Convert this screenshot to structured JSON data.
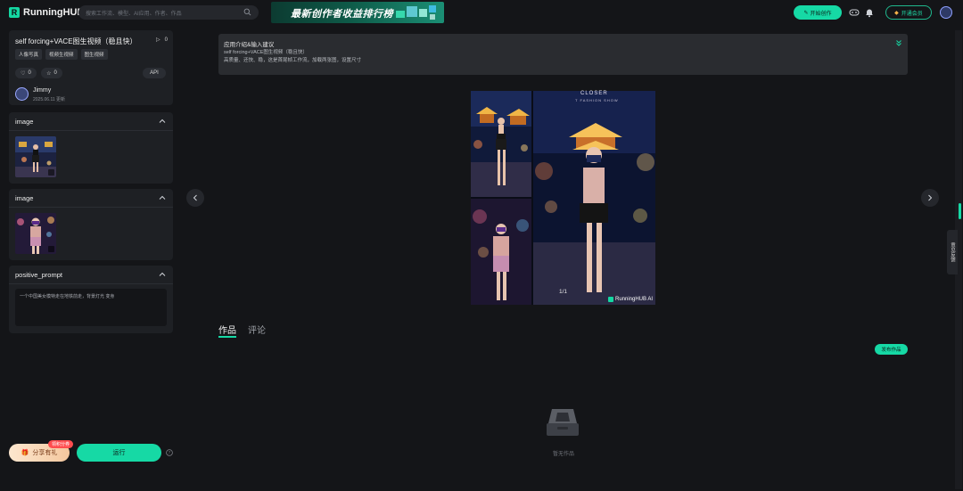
{
  "header": {
    "logo_text": "RunningHUB",
    "search_placeholder": "搜索工作流、模型、AI应用、作者、作品",
    "banner_text": "最新创作者收益排行榜",
    "create_label": "开始创作",
    "vip_label": "开通会员"
  },
  "workflow": {
    "title": "self forcing+VACE图生视频（稳且快）",
    "run_count": "0",
    "tags": [
      "人像写真",
      "视频生视频",
      "图生视频"
    ],
    "likes": "0",
    "favorites": "0",
    "api_label": "API",
    "author_name": "Jimmy",
    "updated": "2025.06.11 更新"
  },
  "panels": {
    "image1_label": "image",
    "image2_label": "image",
    "prompt_label": "positive_prompt",
    "prompt_value": "一个中国美女模特走在地铁前走，背景灯光 变身"
  },
  "actions": {
    "share_label": "分享有礼",
    "share_badge": "领积分券",
    "run_label": "运行"
  },
  "intro": {
    "title": "应用介绍&输入建议",
    "line1": "self forcing+VACE图生视频（稳且快）",
    "line2": "高质量、还快、稳，这是首尾帧工作流，加载两张图，设置尺寸"
  },
  "gallery": {
    "counter": "1/1",
    "watermark": "RunningHUB AI",
    "caption_main": "CLOSER",
    "caption_sub": "T FASHION SHOW"
  },
  "tabs": {
    "works": "作品",
    "comments": "评论"
  },
  "works": {
    "publish_label": "发布作品",
    "empty_text": "暂无作品"
  },
  "sidebar_float": {
    "feedback_label": "意见反馈"
  },
  "colors": {
    "accent": "#16d9a5",
    "background": "#141518",
    "panel": "#1e2024"
  }
}
